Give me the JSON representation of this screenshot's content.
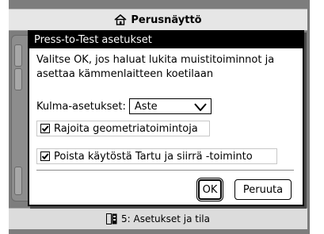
{
  "app": {
    "title": "Perusnäyttö",
    "title_icon": "home-icon"
  },
  "statusbar": {
    "icon": "page-icon",
    "text": "5: Asetukset ja tila"
  },
  "dialog": {
    "title": "Press-to-Test asetukset",
    "message": "Valitse OK, jos haluat lukita muistitoiminnot ja asettaa kämmenlaitteen koetilaan",
    "angle_label": "Kulma-asetukset:",
    "angle_value": "Aste",
    "checkboxes": [
      {
        "label": "Rajoita geometriatoimintoja",
        "checked": true
      },
      {
        "label": "Poista käytöstä Tartu ja siirrä -toiminto",
        "checked": true
      }
    ],
    "ok_label": "OK",
    "cancel_label": "Peruuta"
  }
}
